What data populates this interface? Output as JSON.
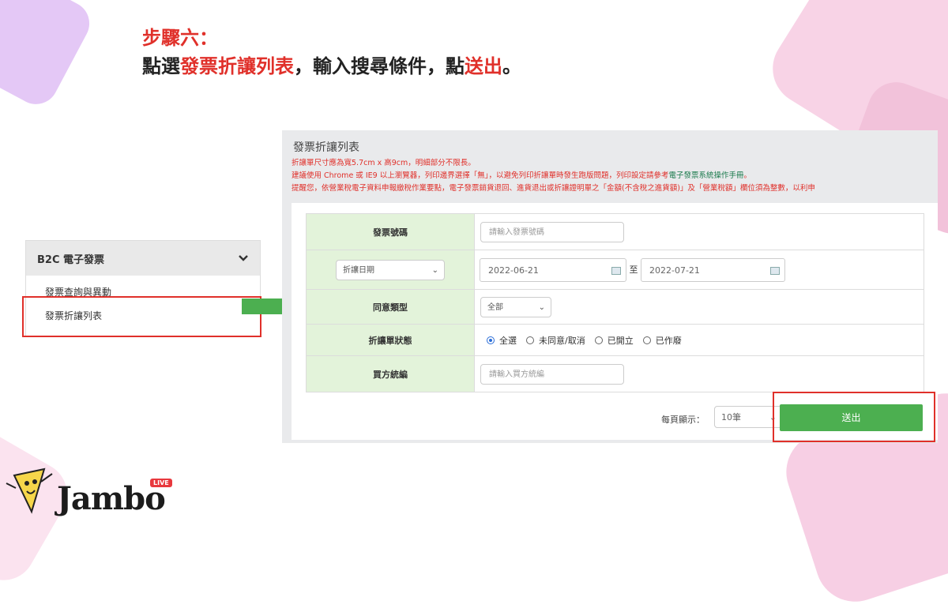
{
  "slide": {
    "step_label": "步驟六：",
    "instruction": {
      "part1": "點選",
      "part2": "發票折讓列表",
      "part3": "，輸入搜尋條件，點",
      "part4": "送出",
      "part5": "。"
    }
  },
  "sidebar": {
    "header": "B2C 電子發票",
    "items": [
      {
        "label": "發票查詢與異動"
      },
      {
        "label": "發票折讓列表"
      }
    ]
  },
  "panel": {
    "title": "發票折讓列表",
    "notes": [
      "折讓單尺寸應為寬5.7cm x 高9cm，明細部分不限長。",
      "建議使用 Chrome 或 IE9 以上瀏覽器，列印邊界選擇「無」，以避免列印折讓單時發生跑版問題，列印設定請參考",
      "電子發票系統操作手冊",
      "。",
      "提醒您，依營業稅電子資料申報繳稅作業要點，電子發票銷貨退回、進貨退出或折讓證明單之「金額(不含稅之進貨額)」及「營業稅額」欄位須為整數，以利申"
    ]
  },
  "form": {
    "invoice_no_label": "發票號碼",
    "invoice_no_placeholder": "請輸入發票號碼",
    "date_type_select": "折讓日期",
    "date_from": "2022-06-21",
    "date_sep": "至",
    "date_to": "2022-07-21",
    "consent_label": "同意類型",
    "consent_select": "全部",
    "status_label": "折讓單狀態",
    "status_options": [
      "全選",
      "未同意/取消",
      "已開立",
      "已作廢"
    ],
    "status_selected": "全選",
    "buyer_label": "買方統編",
    "buyer_placeholder": "請輸入買方統編",
    "per_page_label": "每頁顯示：",
    "per_page_value": "10筆",
    "submit_label": "送出"
  },
  "brand": {
    "logo_text": "Jambo",
    "live_badge": "LIVE"
  },
  "colors": {
    "accent_red": "#e0302a",
    "submit_green": "#4caf50",
    "label_bg": "#e3f3da",
    "arrow_green": "#4caf50"
  }
}
